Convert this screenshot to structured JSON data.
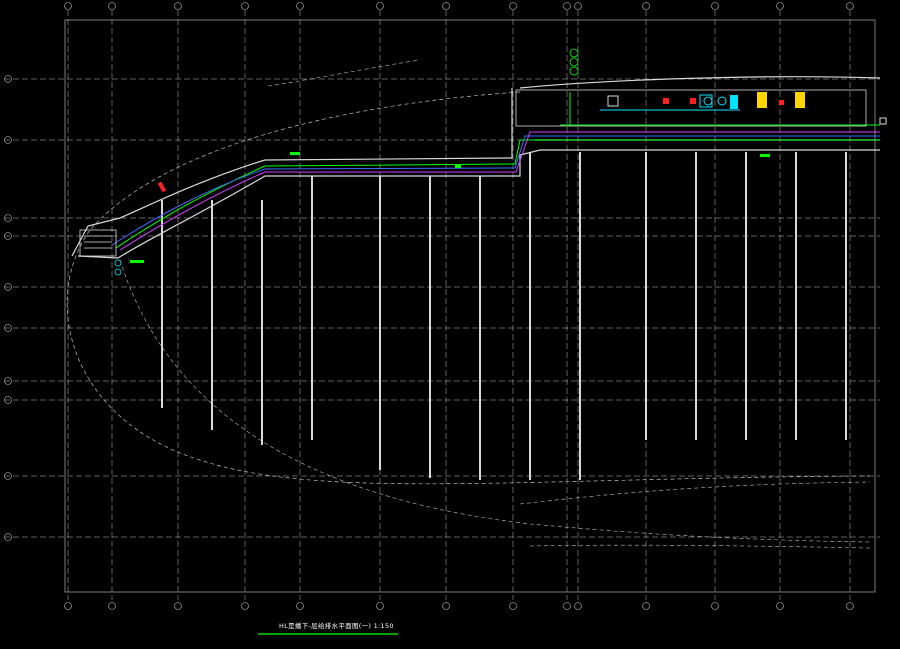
{
  "drawing": {
    "title": "HL是播下-层给排水平面图(一) 1:150",
    "colors": {
      "background": "#000000",
      "grid": "#bfbfbf",
      "wall": "#d9d9d9",
      "pipe_green": "#00ff00",
      "pipe_blue": "#3d6bff",
      "pipe_magenta": "#d040ff",
      "equipment_cyan": "#00e5ff",
      "equipment_yellow": "#ffd400",
      "equipment_red": "#ff2020"
    }
  }
}
